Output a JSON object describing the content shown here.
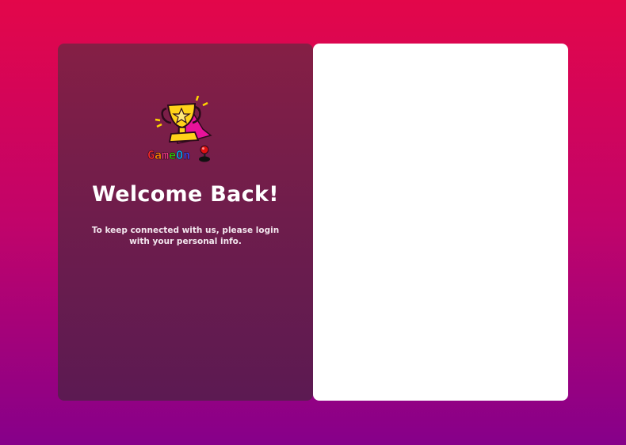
{
  "brand": {
    "name_parts": [
      "G",
      "a",
      "m",
      "e",
      "O",
      "n"
    ],
    "name_colors": [
      "#ff2a2a",
      "#ff8a00",
      "#2bd400",
      "#00b7ff",
      "#3a4bff",
      "#8a2be2"
    ],
    "logo_icon": "trophy-icon",
    "joystick_icon": "joystick-icon"
  },
  "left_panel": {
    "title": "Welcome Back!",
    "subtitle": "To keep connected with us, please login with your personal info."
  },
  "colors": {
    "bg_top": "#e3064a",
    "bg_bottom": "#86008a",
    "panel_left": "#7a1e48",
    "panel_right": "#ffffff"
  }
}
